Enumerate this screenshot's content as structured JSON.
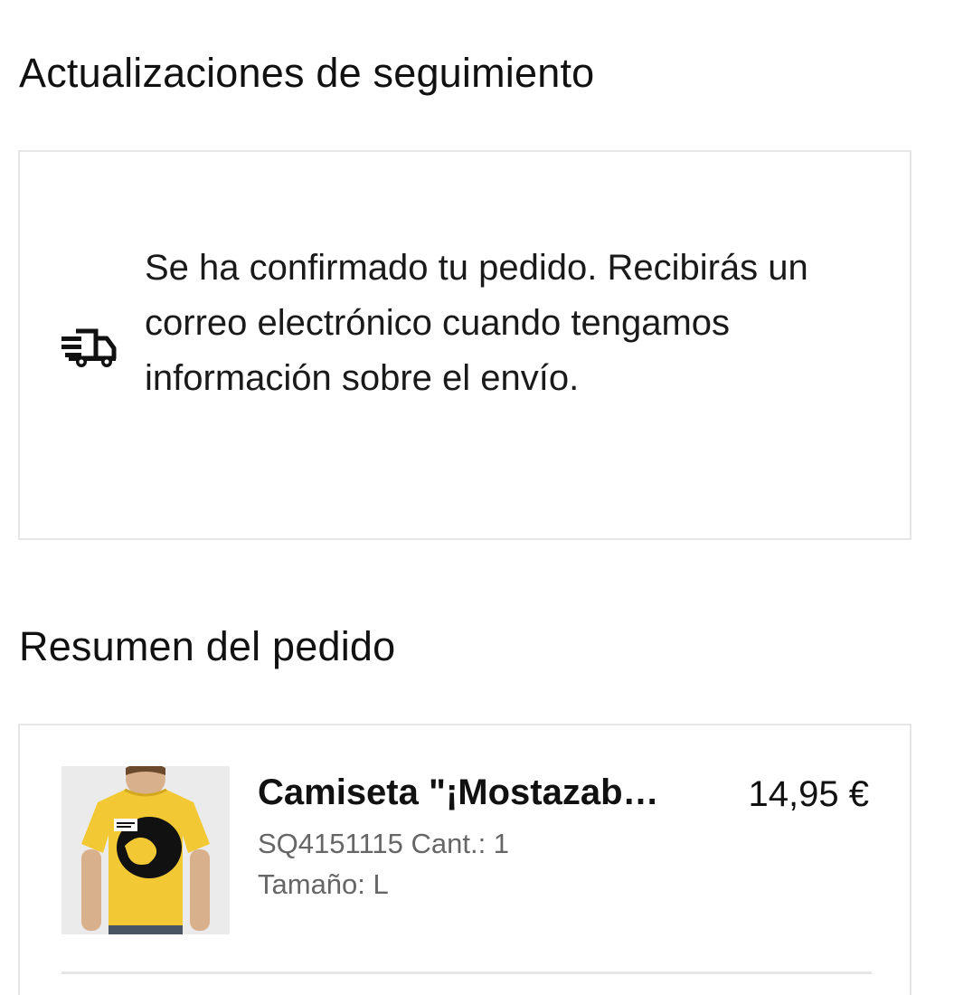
{
  "tracking": {
    "title": "Actualizaciones de seguimiento",
    "icon": "truck-icon",
    "message": "Se ha confirmado tu pedido. Recibirás un correo electrónico cuando tengamos información sobre el envío."
  },
  "summary": {
    "title": "Resumen del pedido",
    "items": [
      {
        "title": "Camiseta \"¡Mostazab…",
        "price": "14,95 €",
        "sku_qty": "SQ4151115 Cant.: 1",
        "size": "Tamaño: L",
        "image_color": "#f2c934"
      }
    ]
  }
}
